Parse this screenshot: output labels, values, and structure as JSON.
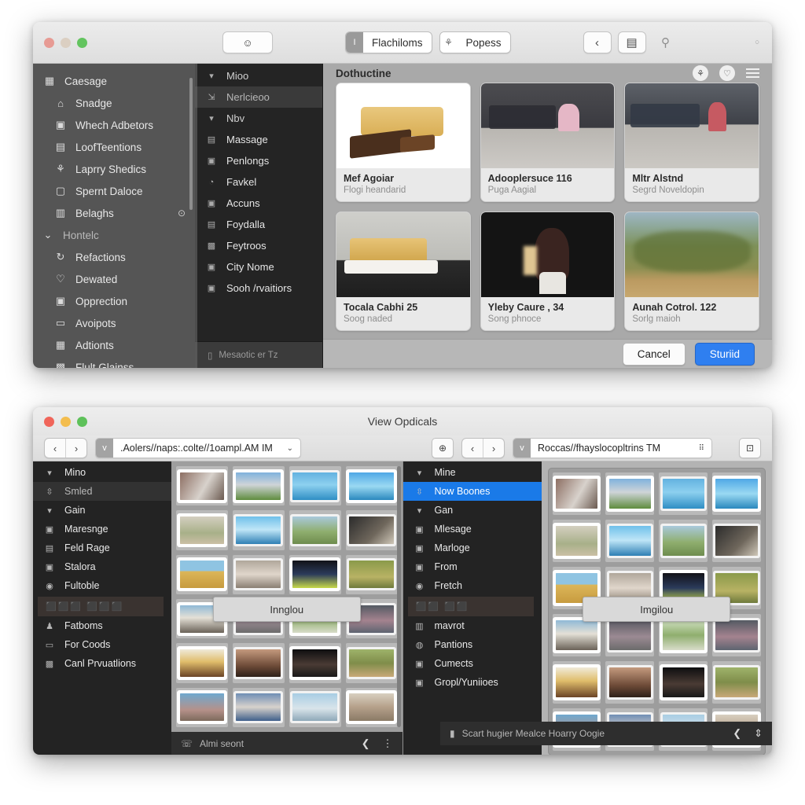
{
  "window1": {
    "title": "",
    "toolbar": {
      "emoji_button": "☺",
      "segments": [
        {
          "icon": "I",
          "label": "Flachiloms"
        },
        {
          "icon": "⚘",
          "label": "Popess"
        }
      ],
      "nav_back": "‹",
      "nav_panel": "▤",
      "nav_person": "⚲",
      "right_status": "○"
    },
    "sidebar": {
      "top_item": {
        "icon": "▦",
        "label": "Caesage"
      },
      "items": [
        {
          "icon": "⌂",
          "label": "Snadge"
        },
        {
          "icon": "▣",
          "label": "Whech Adbetors"
        },
        {
          "icon": "▤",
          "label": "LoofTeentions"
        },
        {
          "icon": "⚘",
          "label": "Laprry Shedics"
        },
        {
          "icon": "▢",
          "label": "Spernt Daloce"
        },
        {
          "icon": "▥",
          "label": "Belaghs",
          "trailing": "⊙"
        }
      ],
      "group_label": "Hontelc",
      "group_items": [
        {
          "icon": "↻",
          "label": "Refactions"
        },
        {
          "icon": "♡",
          "label": "Dewated"
        },
        {
          "icon": "▣",
          "label": "Opprection"
        },
        {
          "icon": "▭",
          "label": "Avoipots"
        },
        {
          "icon": "▦",
          "label": "Adtionts"
        },
        {
          "icon": "▩",
          "label": "Flult Glainss"
        }
      ]
    },
    "sidebar2": {
      "items": [
        {
          "icon": "▾",
          "label": "Mioo",
          "type": "group"
        },
        {
          "icon": "⇲",
          "label": "Nerlcieoo",
          "type": "selected"
        },
        {
          "icon": "▾",
          "label": "Nbv",
          "type": "group"
        },
        {
          "icon": "▤",
          "label": "Massage"
        },
        {
          "icon": "▣",
          "label": "Penlongs"
        },
        {
          "icon": "◔",
          "label": "Favkel"
        },
        {
          "icon": "▣",
          "label": "Accuns"
        },
        {
          "icon": "▤",
          "label": "Foydalla"
        },
        {
          "icon": "▩",
          "label": "Feytroos"
        },
        {
          "icon": "▣",
          "label": "City Nome"
        },
        {
          "icon": "▣",
          "label": "Sooh /rvaitiors"
        }
      ],
      "footer": {
        "icon": "▯",
        "label": "Mesaotic er Tz"
      }
    },
    "content": {
      "heading": "Dothuctine",
      "actions": [
        "share-icon",
        "shield-icon",
        "hamburger-icon"
      ],
      "cards": [
        {
          "title": "Mef Agoiar",
          "subtitle": "Flogi heandarid",
          "img": "cake-chocolate"
        },
        {
          "title": "Adooplersuce  116",
          "subtitle": "Puga Aagial",
          "img": "crowd-pink-dress"
        },
        {
          "title": "Mltr Alstnd",
          "subtitle": "Segrd Noveldopin",
          "img": "crowd-red-dress"
        },
        {
          "title": "Tocala Cabhi  25",
          "subtitle": "Soog naded",
          "img": "cake-plate"
        },
        {
          "title": "Yleby Caure ,  34",
          "subtitle": "Song phnoce",
          "img": "woman-sparkler"
        },
        {
          "title": "Aunah Cotrol.  122",
          "subtitle": "Sorlg maioh",
          "img": "bush-landscape"
        }
      ]
    },
    "footer": {
      "cancel": "Cancel",
      "confirm": "Sturiid"
    }
  },
  "window2": {
    "title": "View Opdicals",
    "toolbar_left": {
      "back": "‹",
      "forward": "›",
      "path_icon": "v",
      "path_value": ".Aolers//naps:.colte//1oampl.AM IM",
      "caret": "⌄"
    },
    "toolbar_right": {
      "refresh": "⊕",
      "back": "‹",
      "forward": "›",
      "path_icon": "v",
      "path_value": "Roccas//fhayslocopltrins TM",
      "grip": "⠿",
      "end_button": "⊡"
    },
    "left_sidebar": {
      "items": [
        {
          "icon": "▾",
          "label": "Mino",
          "type": "group"
        },
        {
          "icon": "⇳",
          "label": "Smled",
          "type": "sel-grey"
        },
        {
          "icon": "▾",
          "label": "Gain",
          "type": "group"
        },
        {
          "icon": "▣",
          "label": "Maresnge"
        },
        {
          "icon": "▤",
          "label": "Feld Rage"
        },
        {
          "icon": "▣",
          "label": "Stalora"
        },
        {
          "icon": "◉",
          "label": "Fultoble"
        },
        {
          "icon": "",
          "label": "",
          "type": "glitch",
          "glitch_text": "⬛⬛⬛ ⬛⬛⬛"
        },
        {
          "icon": "♟",
          "label": "Fatboms"
        },
        {
          "icon": "▭",
          "label": "For Coods"
        },
        {
          "icon": "▩",
          "label": "Canl Prvuatlions"
        }
      ]
    },
    "left_grid": {
      "overlay_label": "Innglou",
      "footer": {
        "icon": "☏",
        "label": "Almi seont",
        "back": "❮",
        "more": "⋮"
      }
    },
    "right_sidebar": {
      "items": [
        {
          "icon": "▾",
          "label": "Mine",
          "type": "group"
        },
        {
          "icon": "⇳",
          "label": "Now Boones",
          "type": "sel-blue"
        },
        {
          "icon": "▾",
          "label": "Gan",
          "type": "group"
        },
        {
          "icon": "▣",
          "label": "Mlesage"
        },
        {
          "icon": "▣",
          "label": "Marloge"
        },
        {
          "icon": "▣",
          "label": "From"
        },
        {
          "icon": "◉",
          "label": "Fretch"
        },
        {
          "icon": "",
          "label": "",
          "type": "glitch",
          "glitch_text": "⬛⬛ ⬛⬛"
        },
        {
          "icon": "▥",
          "label": "mavrot"
        },
        {
          "icon": "◍",
          "label": "Pantions"
        },
        {
          "icon": "▣",
          "label": "Cumects"
        },
        {
          "icon": "▣",
          "label": "Gropl/Yuniioes"
        }
      ],
      "footer": {
        "icon": "▮",
        "label": "Scart hugier Mealce Hoarry Oogie",
        "back": "❮",
        "more": "⇕"
      }
    },
    "right_grid": {
      "overlay_label": "Imgilou"
    }
  }
}
